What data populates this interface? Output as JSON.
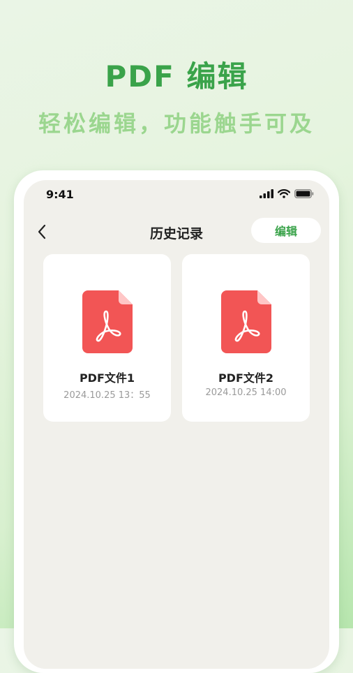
{
  "promo": {
    "title": "PDF 编辑",
    "subtitle": "轻松编辑，功能触手可及"
  },
  "status_bar": {
    "time": "9:41",
    "icons": [
      "signal-icon",
      "wifi-icon",
      "battery-icon"
    ]
  },
  "nav": {
    "back_icon": "chevron-left-icon",
    "title": "历史记录",
    "edit_label": "编辑"
  },
  "files": [
    {
      "name": "PDF文件1",
      "date": "2024.10.25 13：55",
      "icon": "pdf-file-icon"
    },
    {
      "name": "PDF文件2",
      "date": "2024.10.25 14:00",
      "icon": "pdf-file-icon"
    }
  ],
  "colors": {
    "accent": "#3aa34a",
    "subtitle": "#9bd68f",
    "pdf_red": "#f25555",
    "screen_bg": "#f1f0eb"
  }
}
